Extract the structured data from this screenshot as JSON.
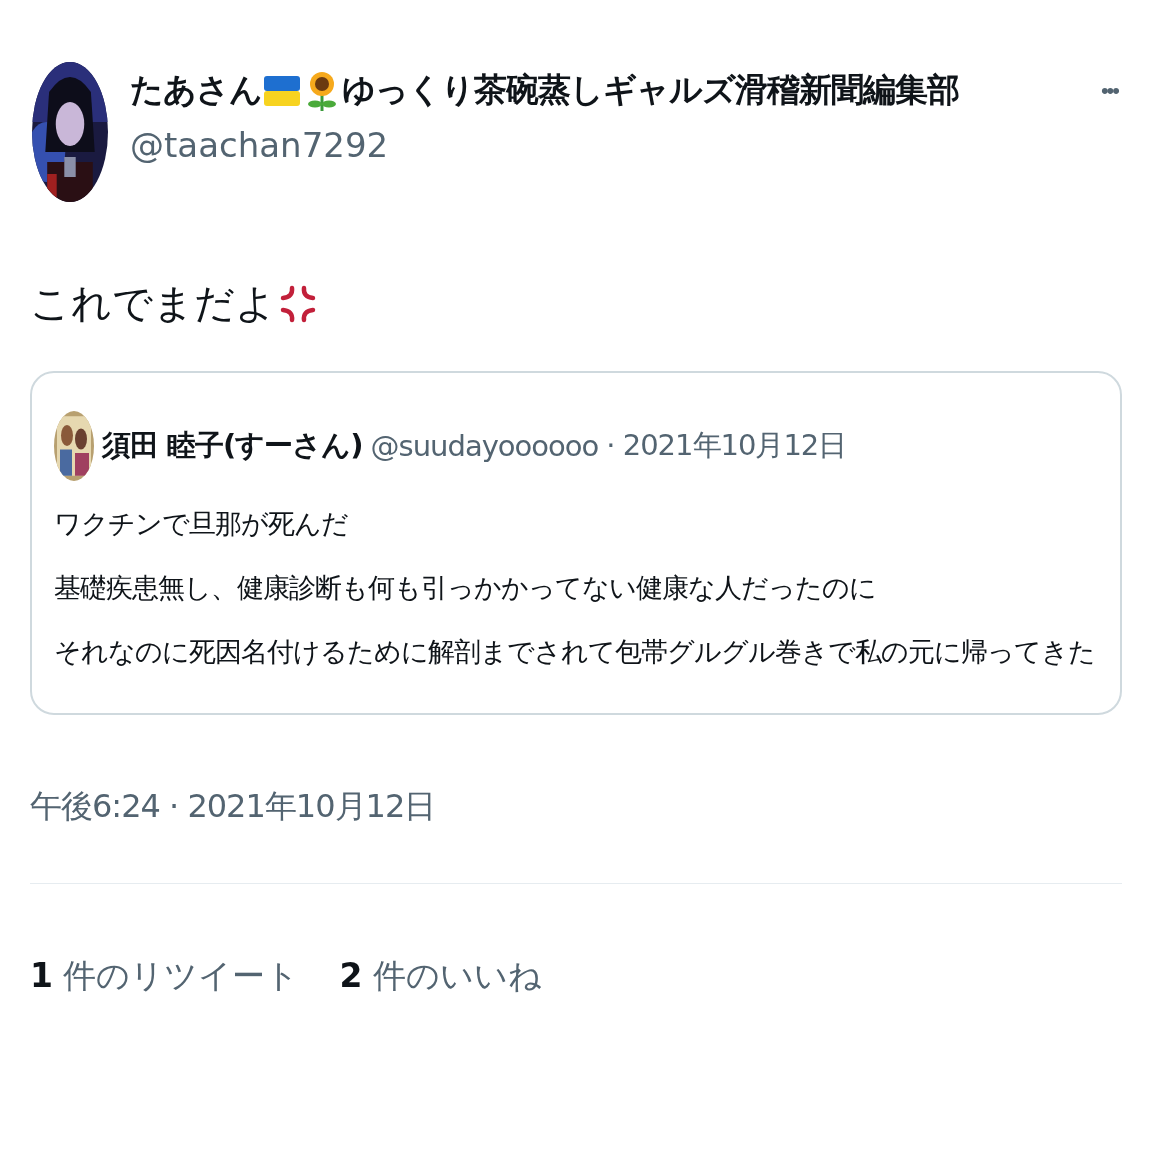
{
  "author": {
    "name_parts": [
      "たあさん",
      "ゆっくり茶碗蒸しギャルズ滑稽新聞編集部"
    ],
    "handle": "@taachan7292"
  },
  "more_menu": "•••",
  "tweet_text": "これでまだよ",
  "quote": {
    "name": "須田 睦子(すーさん)",
    "handle": "@suudayoooooo",
    "date": "· 2021年10月12日",
    "lines": [
      "ワクチンで旦那が死んだ",
      "基礎疾患無し、健康診断も何も引っかかってない健康な人だったのに",
      "それなのに死因名付けるために解剖までされて包帯グルグル巻きで私の元に帰ってきた"
    ]
  },
  "timestamp": "午後6:24 · 2021年10月12日",
  "stats": [
    {
      "count": "1",
      "label": "件のリツイート"
    },
    {
      "count": "2",
      "label": "件のいいね"
    }
  ]
}
